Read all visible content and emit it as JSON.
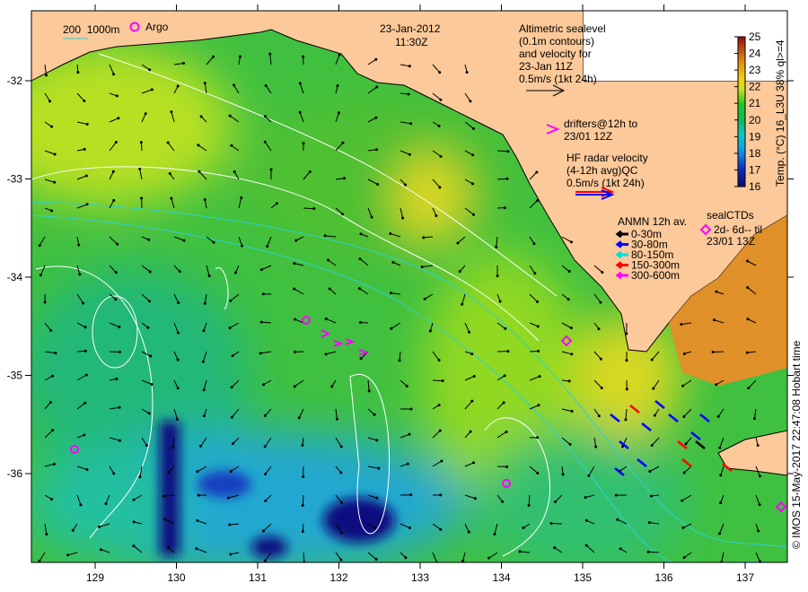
{
  "title": {
    "date": "23-Jan-2012",
    "time": "11:30Z"
  },
  "depth_legend": {
    "label": "200  1000m",
    "color": "#30d0d0"
  },
  "argo_legend": {
    "label": "Argo",
    "color": "#ff00ff"
  },
  "altimetry_legend": {
    "lines": [
      "Altimetric sealevel",
      "(0.1m contours)",
      "and velocity for",
      "23-Jan 11Z",
      "0.5m/s (1kt 24h)"
    ]
  },
  "drifter_legend": {
    "lines": [
      "drifters@12h to",
      "23/01 12Z"
    ]
  },
  "hf_radar_legend": {
    "lines": [
      "HF radar velocity",
      "(4-12h avg)QC",
      "0.5m/s (1kt 24h)"
    ]
  },
  "anmn_legend": {
    "title": "ANMN 12h av.",
    "items": [
      {
        "label": "0-30m",
        "color": "#000000"
      },
      {
        "label": "30-80m",
        "color": "#0000ff"
      },
      {
        "label": "80-150m",
        "color": "#00e0e0"
      },
      {
        "label": "150-300m",
        "color": "#ff0000"
      },
      {
        "label": "300-600m",
        "color": "#ff00ff"
      }
    ]
  },
  "seal_legend": {
    "lines": [
      "sealCTDs",
      "2d- 6d-- til",
      "23/01 13Z"
    ]
  },
  "colorbar": {
    "label": "Temp. (°C) 16_L3U 38% ql>=4",
    "ticks": [
      "16",
      "17",
      "18",
      "19",
      "20",
      "21",
      "22",
      "23",
      "24",
      "25"
    ],
    "min": 16,
    "max": 25
  },
  "axes": {
    "x_ticks": [
      "129",
      "130",
      "131",
      "132",
      "133",
      "134",
      "135",
      "136",
      "137"
    ],
    "y_ticks": [
      "-32",
      "-33",
      "-34",
      "-35",
      "-36"
    ]
  },
  "credit": "© IMOS 15-May-2017 22:47:08 Hobart time",
  "colors": {
    "land": "#fcc99a",
    "coast": "#000000"
  }
}
